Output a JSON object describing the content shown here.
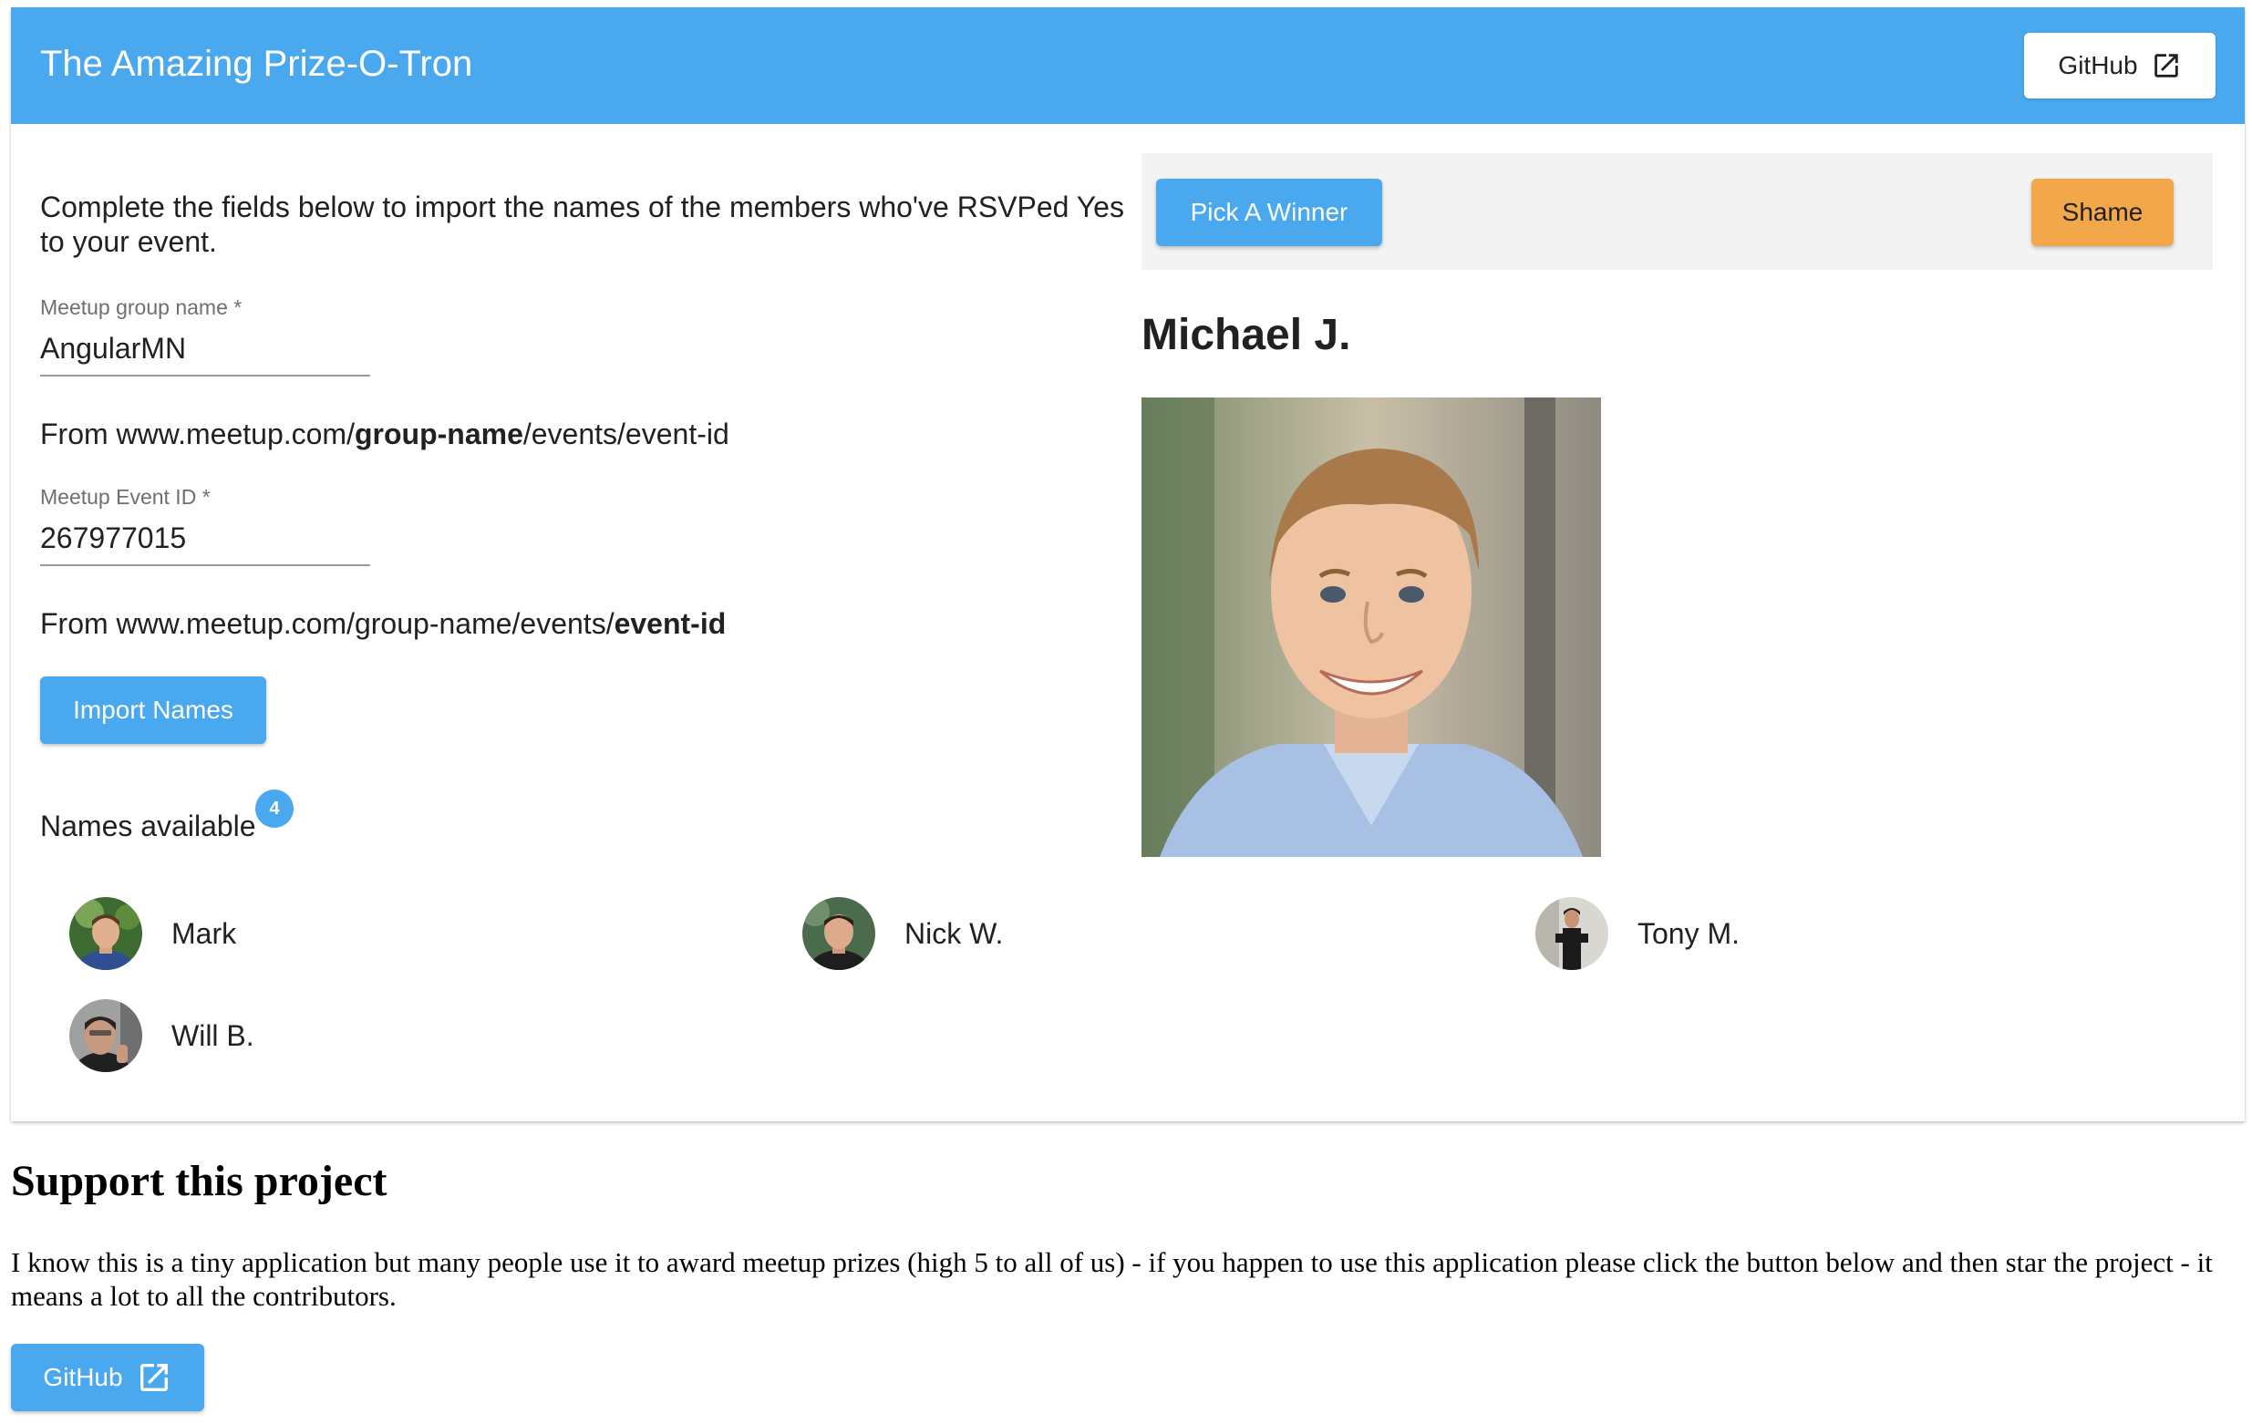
{
  "header": {
    "title": "The Amazing Prize-O-Tron",
    "github_label": "GitHub"
  },
  "form": {
    "intro": "Complete the fields below to import the names of the members who've RSVPed Yes to your event.",
    "group_field": {
      "label": "Meetup group name *",
      "value": "AngularMN"
    },
    "group_hint": {
      "prefix": "From www.meetup.com/",
      "bold": "group-name",
      "suffix": "/events/event-id"
    },
    "event_field": {
      "label": "Meetup Event ID *",
      "value": "267977015"
    },
    "event_hint": {
      "prefix": "From www.meetup.com/group-name/events/",
      "bold": "event-id"
    },
    "import_label": "Import Names"
  },
  "names": {
    "label": "Names available",
    "count": "4",
    "people": [
      {
        "name": "Mark"
      },
      {
        "name": "Nick W."
      },
      {
        "name": "Tony M."
      },
      {
        "name": "Will B."
      }
    ]
  },
  "winner_panel": {
    "pick_label": "Pick A Winner",
    "shame_label": "Shame",
    "winner_name": "Michael J."
  },
  "support": {
    "title": "Support this project",
    "text": "I know this is a tiny application but many people use it to award meetup prizes (high 5 to all of us) - if you happen to use this application please click the button below and then star the project - it means a lot to all the contributors.",
    "github_label": "GitHub"
  },
  "colors": {
    "primary": "#4aa8ee",
    "accent": "#f2a84a",
    "surface": "#f3f3f3"
  }
}
